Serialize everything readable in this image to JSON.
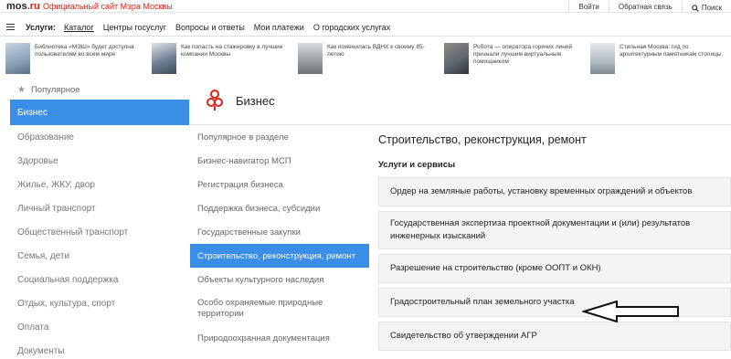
{
  "topbar": {
    "logo_main": "mos",
    "logo_tld": ".ru",
    "site_title": "Официальный сайт Мэра Москвы",
    "links": [
      "Войти",
      "Обратная связь"
    ],
    "search_label": "Поиск"
  },
  "navbar": {
    "label": "Услуги:",
    "items": [
      "Каталог",
      "Центры госуслуг",
      "Вопросы и ответы",
      "Мои платежи",
      "О городских услугах"
    ]
  },
  "news": [
    {
      "text": "Библиотека «МЭШ» будет доступна пользователям во всем мире",
      "color": "#8aa0b8"
    },
    {
      "text": "Как попасть на стажировку в лучшие компании Москвы",
      "color": "#6f8196"
    },
    {
      "text": "Как изменилась ВДНХ к своему 85-летию",
      "color": "#a3a7ab"
    },
    {
      "text": "Робота — оператора горячих линий признали лучшим виртуальным помощником",
      "color": "#5f6770"
    },
    {
      "text": "Стильная Москва: гид по архитектурным памятникам столицы",
      "color": "#b6c0c6"
    }
  ],
  "sidebar": {
    "popular": "Популярное",
    "items": [
      "Бизнес",
      "Образование",
      "Здоровье",
      "Жилье, ЖКУ, двор",
      "Личный транспорт",
      "Общественный транспорт",
      "Семья, дети",
      "Социальная поддержка",
      "Отдых, культура, спорт",
      "Оплата",
      "Документы"
    ]
  },
  "main": {
    "title": "Бизнес"
  },
  "subnav": {
    "items": [
      "Популярное в разделе",
      "Бизнес-навигатор МСП",
      "Регистрация бизнеса",
      "Поддержка бизнеса, субсидии",
      "Государственные закупки",
      "Строительство, реконструкция, ремонт",
      "Объекты культурного наследия",
      "Особо охраняемые природные территории",
      "Природоохранная документация"
    ]
  },
  "content": {
    "title": "Строительство, реконструкция, ремонт",
    "section": "Услуги и сервисы",
    "cards": [
      "Ордер на земляные работы, установку временных ограждений и объектов",
      "Государственная экспертиза проектной документации и (или) результатов инженерных изысканий",
      "Разрешение на строительство (кроме ООПТ и ОКН)",
      "Градостроительный план земельного участка",
      "Свидетельство об утверждении АГР"
    ]
  },
  "colors": {
    "accent": "#d7251b",
    "active_blue": "#3a8ee6"
  }
}
